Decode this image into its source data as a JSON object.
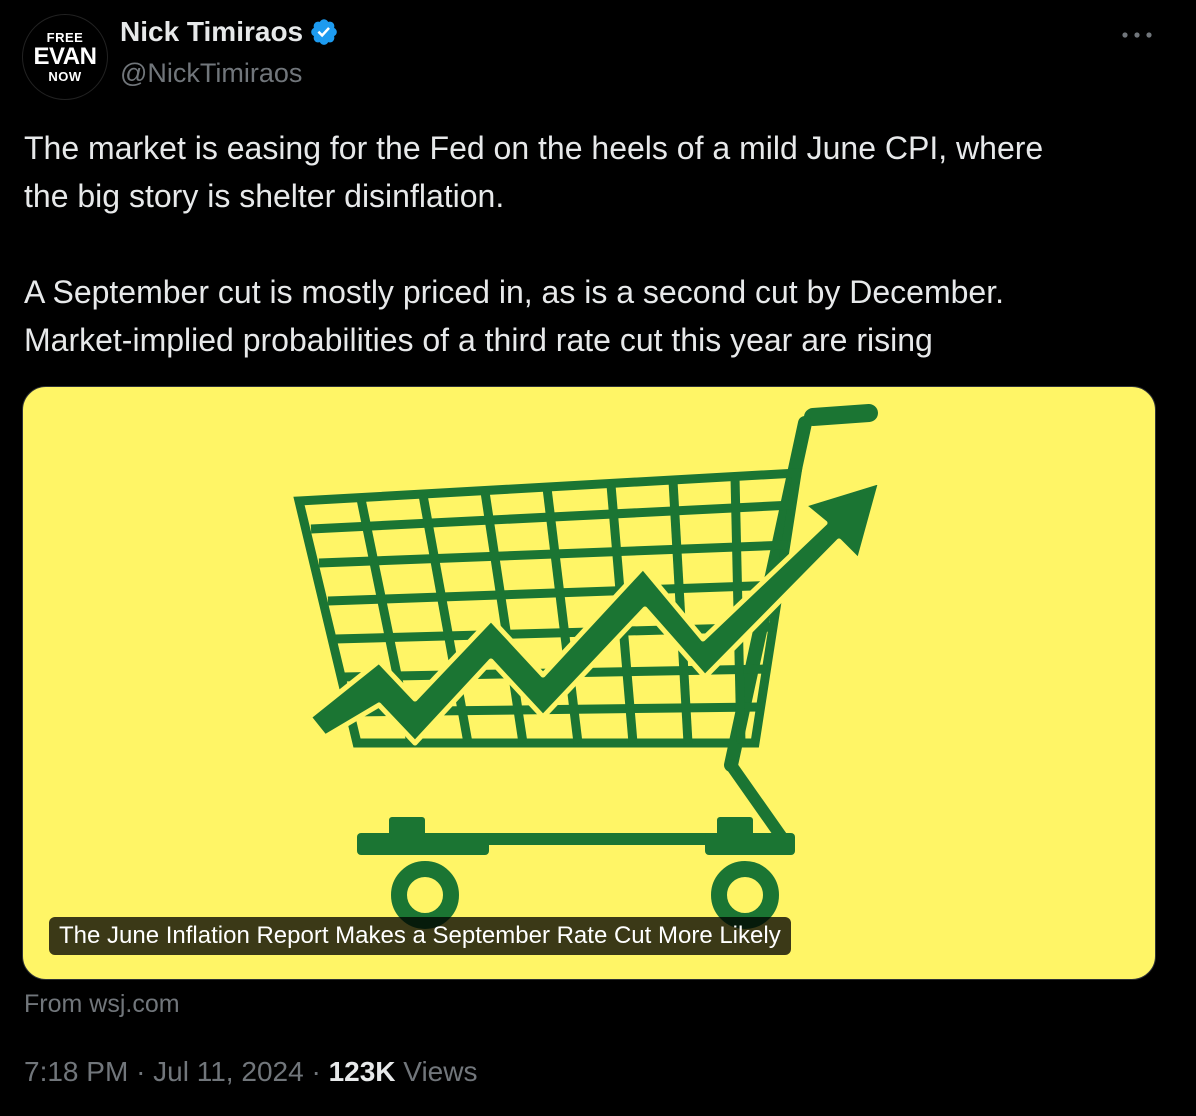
{
  "author": {
    "avatar": {
      "line1": "FREE",
      "line2": "EVAN",
      "line3": "NOW"
    },
    "name": "Nick Timiraos",
    "handle": "@NickTimiraos",
    "verified_icon": "verified-badge-icon",
    "verified_color": "#1d9bf0"
  },
  "tweet": {
    "paragraph1_line1": "The market is easing for the Fed on the heels of a mild June CPI, where",
    "paragraph1_line2": "the big story is shelter disinflation.",
    "paragraph2_line1": "A September cut is mostly priced in, as is a second cut by December.",
    "paragraph2_line2": "Market-implied probabilities of a third rate cut this year are rising"
  },
  "card": {
    "image": "shopping-cart-with-rising-arrow",
    "background_color": "#fff566",
    "art_color": "#1b7533",
    "caption": "The June Inflation Report Makes a September Rate Cut More Likely",
    "source": "From wsj.com"
  },
  "meta": {
    "time": "7:18 PM",
    "separator": "·",
    "date": "Jul 11, 2024",
    "views_count": "123K",
    "views_label": "Views"
  },
  "icons": {
    "more": "more-options-icon"
  }
}
